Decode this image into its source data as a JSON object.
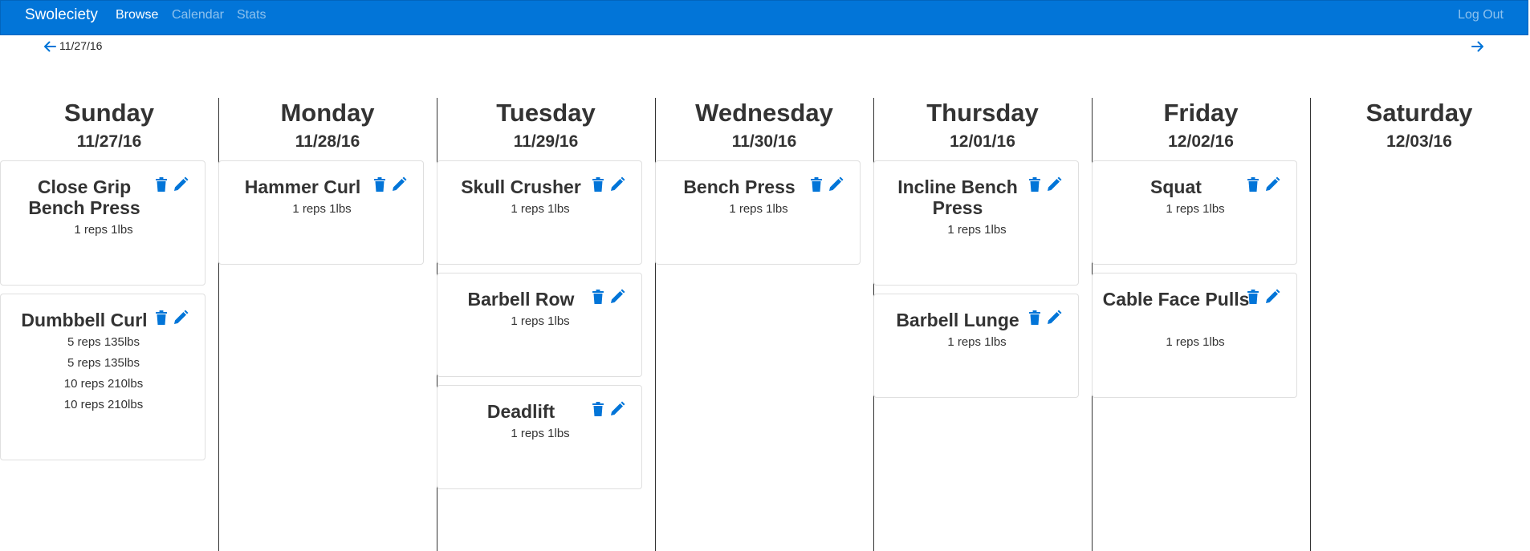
{
  "navbar": {
    "brand": "Swoleciety",
    "links": {
      "browse": "Browse",
      "calendar": "Calendar",
      "stats": "Stats"
    },
    "logout": "Log Out",
    "color": "#0275d8"
  },
  "week_nav": {
    "current_date": "11/27/16",
    "prev_icon": "arrow-left-icon",
    "next_icon": "arrow-right-icon"
  },
  "days": [
    {
      "name": "Sunday",
      "date": "11/27/16",
      "exercises": [
        {
          "title": "Close Grip Bench Press",
          "sets": [
            "1 reps 1lbs"
          ]
        },
        {
          "title": "Dumbbell Curl",
          "sets": [
            "5 reps 135lbs",
            "5 reps 135lbs",
            "10 reps 210lbs",
            "10 reps 210lbs"
          ]
        }
      ]
    },
    {
      "name": "Monday",
      "date": "11/28/16",
      "exercises": [
        {
          "title": "Hammer Curl",
          "sets": [
            "1 reps 1lbs"
          ]
        }
      ]
    },
    {
      "name": "Tuesday",
      "date": "11/29/16",
      "exercises": [
        {
          "title": "Skull Crusher",
          "sets": [
            "1 reps 1lbs"
          ]
        },
        {
          "title": "Barbell Row",
          "sets": [
            "1 reps 1lbs"
          ]
        },
        {
          "title": "Deadlift",
          "sets": [
            "1 reps 1lbs"
          ]
        }
      ]
    },
    {
      "name": "Wednesday",
      "date": "11/30/16",
      "exercises": [
        {
          "title": "Bench Press",
          "sets": [
            "1 reps 1lbs"
          ]
        }
      ]
    },
    {
      "name": "Thursday",
      "date": "12/01/16",
      "exercises": [
        {
          "title": "Incline Bench Press",
          "sets": [
            "1 reps 1lbs"
          ]
        },
        {
          "title": "Barbell Lunge",
          "sets": [
            "1 reps 1lbs"
          ]
        }
      ]
    },
    {
      "name": "Friday",
      "date": "12/02/16",
      "exercises": [
        {
          "title": "Squat",
          "sets": [
            "1 reps 1lbs"
          ]
        },
        {
          "title": "Cable Face Pulls",
          "sets": [
            "1 reps 1lbs"
          ]
        }
      ]
    },
    {
      "name": "Saturday",
      "date": "12/03/16",
      "exercises": []
    }
  ],
  "icons": {
    "delete": "trash-icon",
    "edit": "pencil-icon",
    "color": "#0275d8"
  }
}
